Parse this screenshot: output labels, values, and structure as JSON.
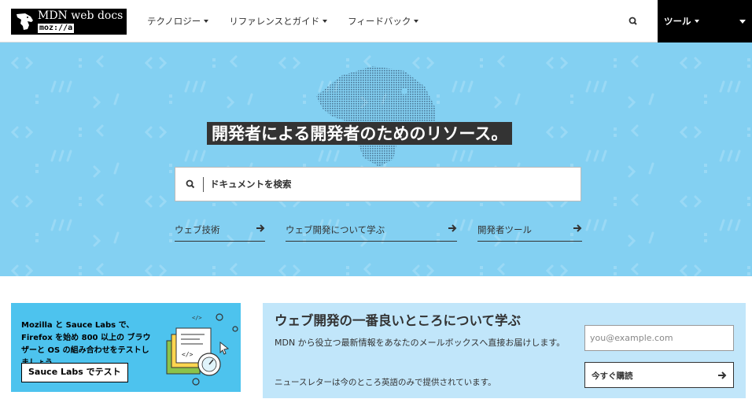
{
  "header": {
    "logo_title": "MDN web docs",
    "logo_sub": "moz://a",
    "nav": [
      {
        "label": "テクノロジー"
      },
      {
        "label": "リファレンスとガイド"
      },
      {
        "label": "フィードバック"
      }
    ],
    "tools_label": "ツール"
  },
  "hero": {
    "title": "開発者による開発者のためのリソース。",
    "search_placeholder": "ドキュメントを検索",
    "links": [
      {
        "label": "ウェブ技術"
      },
      {
        "label": "ウェブ開発について学ぶ"
      },
      {
        "label": "開発者ツール"
      }
    ],
    "bg_color": "#83d0f2"
  },
  "promo": {
    "text": "Mozilla と Sauce Labs で、Firefox を始め 800 以上の ブラウザーと OS の組み合わせをテストしましょう",
    "button": "Sauce Labs でテスト",
    "bg_color": "#4dc3ee"
  },
  "newsletter": {
    "title": "ウェブ開発の一番良いところについて学ぶ",
    "description": "MDN から役立つ最新情報をあなたのメールボックスへ直接お届けします。",
    "note": "ニュースレターは今のところ英語のみで提供されています。",
    "email_placeholder": "you@example.com",
    "submit": "今すぐ購読",
    "bg_color": "#c1e6fa"
  }
}
